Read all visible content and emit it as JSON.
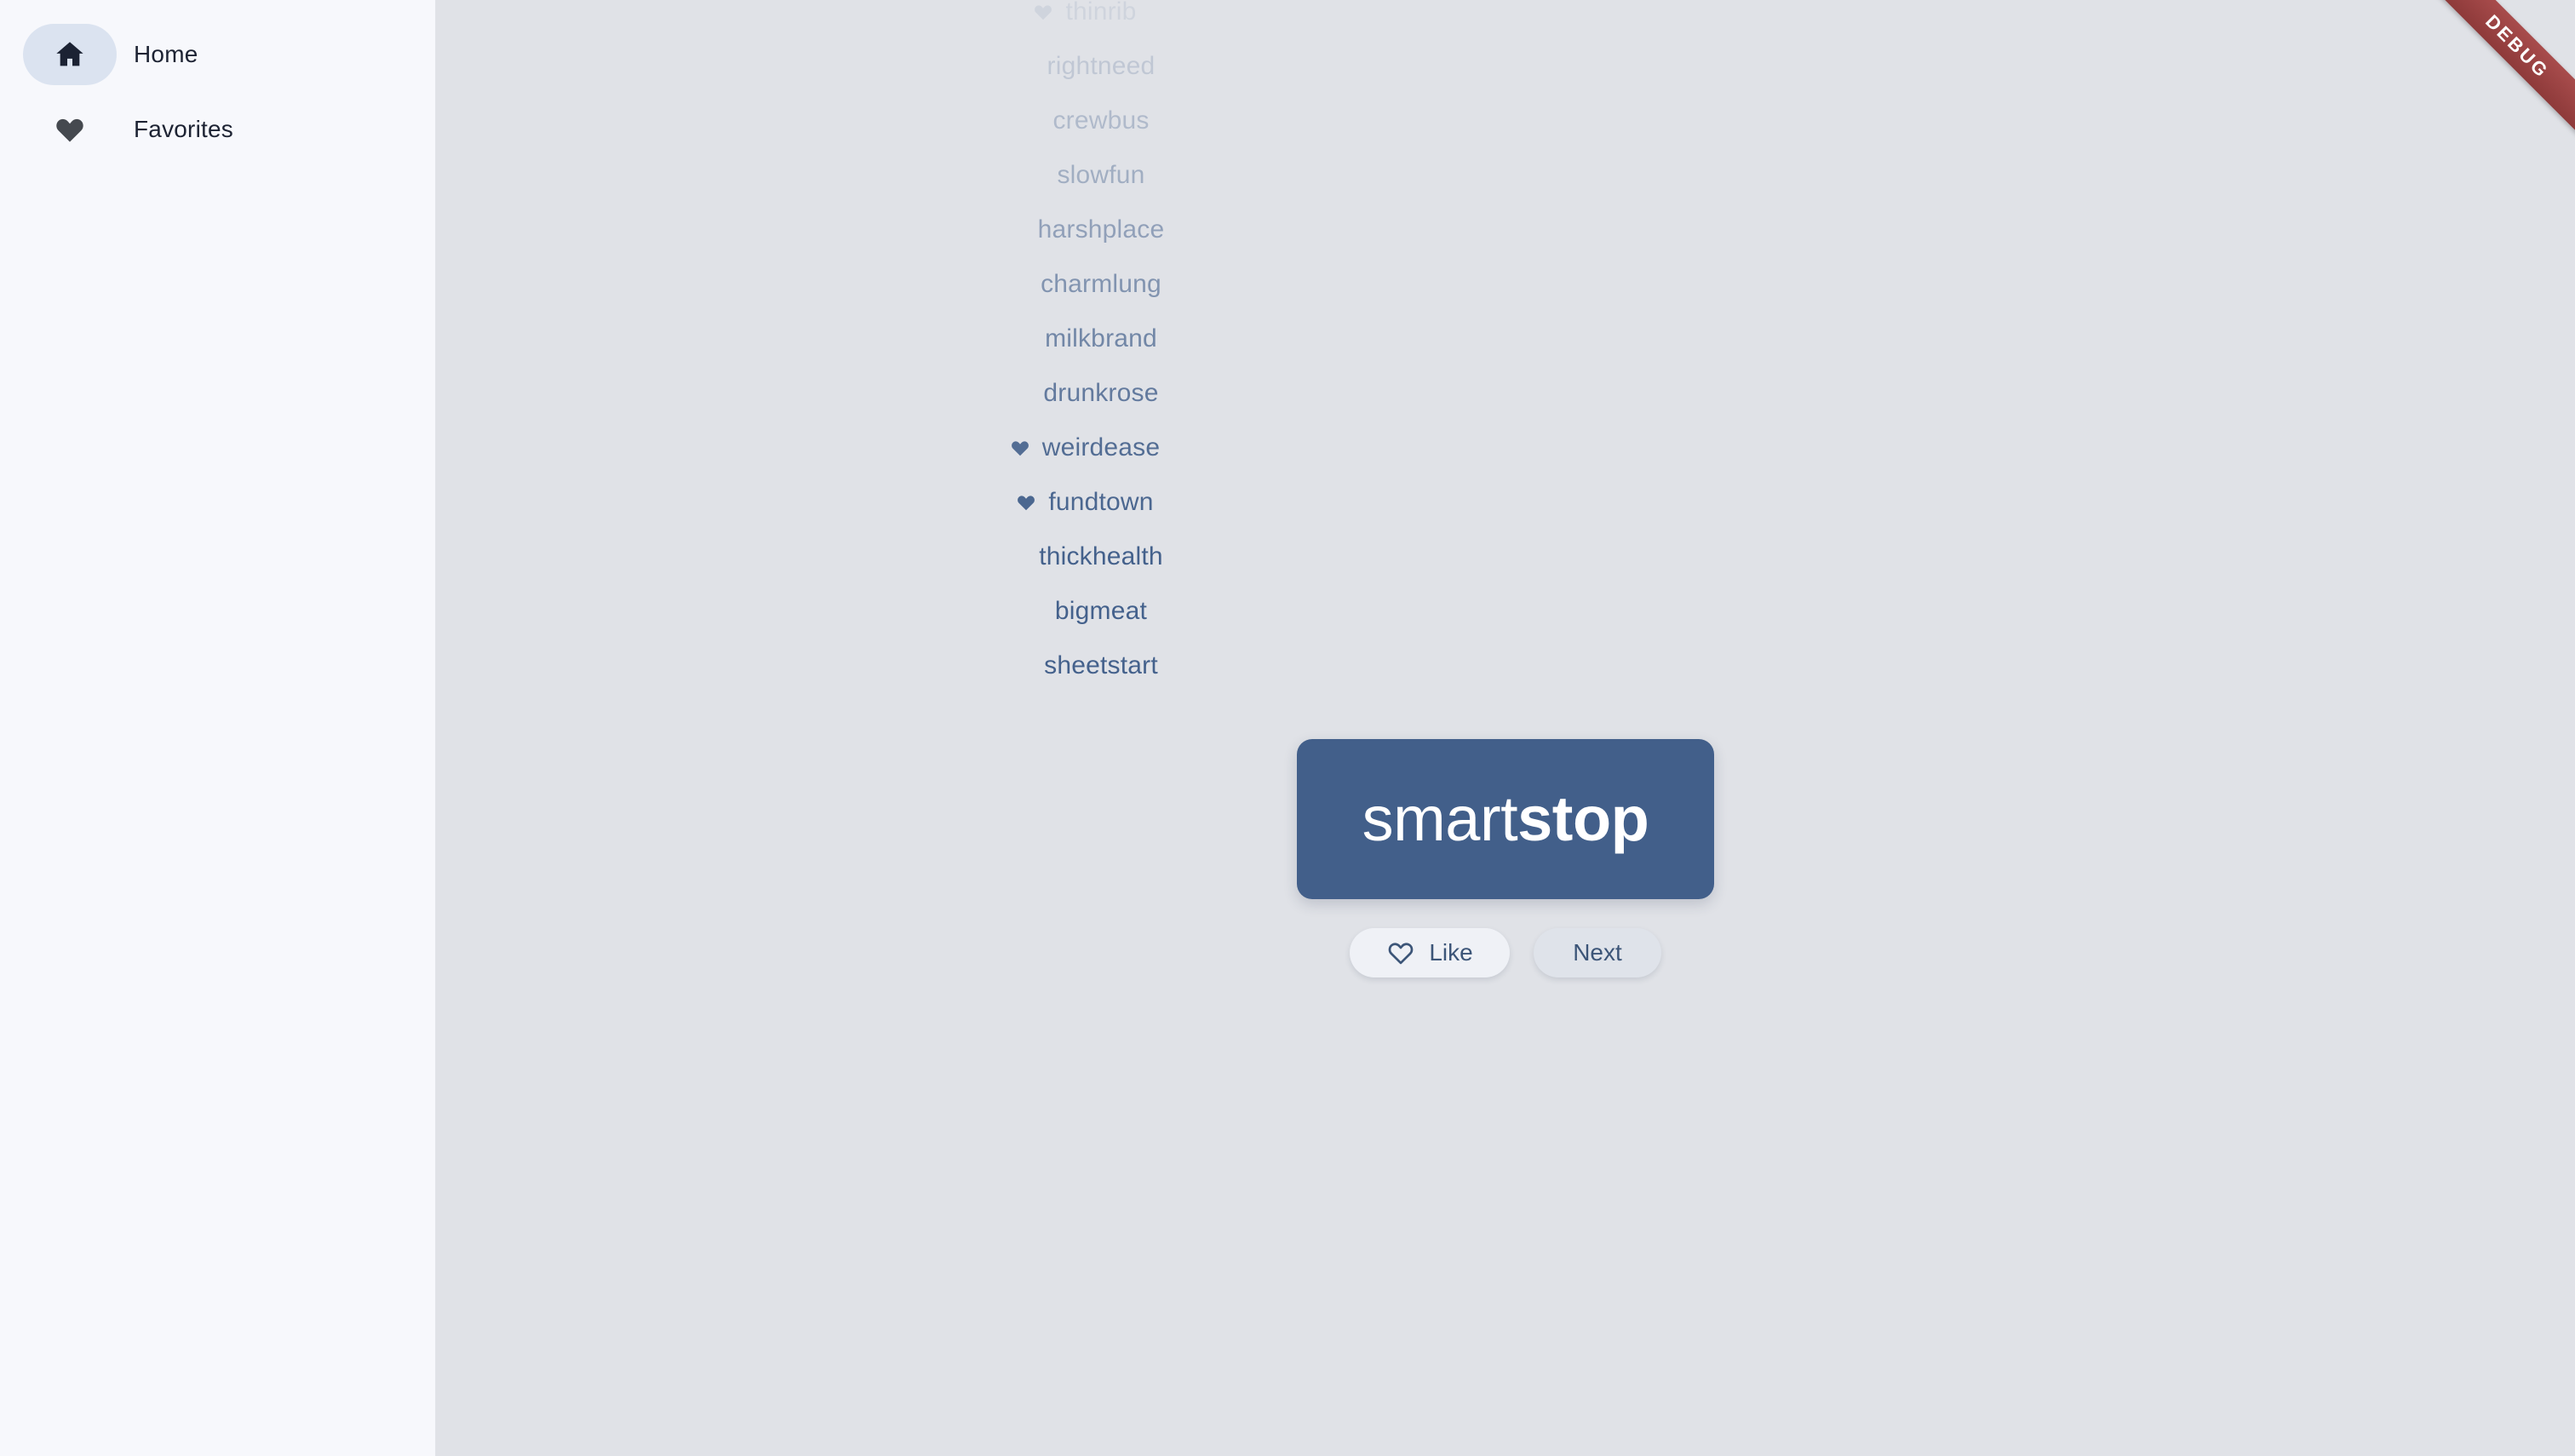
{
  "colors": {
    "sidebar_bg": "#f7f8fc",
    "stage_bg": "#e0e2e7",
    "accent": "#425f8a",
    "word_text": "#44618c",
    "active_pill": "#dbe3f0",
    "like_button_bg": "#eff1f6",
    "next_button_bg": "#dfe3ea",
    "debug_ribbon": "#8e3a3a"
  },
  "sidebar": {
    "items": [
      {
        "label": "Home",
        "icon": "home-icon",
        "active": true
      },
      {
        "label": "Favorites",
        "icon": "heart-filled-icon",
        "active": false
      }
    ]
  },
  "history": {
    "items": [
      {
        "word": "thinrib",
        "liked": true,
        "opacity": 0.1
      },
      {
        "word": "rightneed",
        "liked": false,
        "opacity": 0.2
      },
      {
        "word": "crewbus",
        "liked": false,
        "opacity": 0.3
      },
      {
        "word": "slowfun",
        "liked": false,
        "opacity": 0.4
      },
      {
        "word": "harshplace",
        "liked": false,
        "opacity": 0.5
      },
      {
        "word": "charmlung",
        "liked": false,
        "opacity": 0.6
      },
      {
        "word": "milkbrand",
        "liked": false,
        "opacity": 0.7
      },
      {
        "word": "drunkrose",
        "liked": false,
        "opacity": 0.8
      },
      {
        "word": "weirdease",
        "liked": true,
        "opacity": 0.9
      },
      {
        "word": "fundtown",
        "liked": true,
        "opacity": 0.95
      },
      {
        "word": "thickhealth",
        "liked": false,
        "opacity": 1.0
      },
      {
        "word": "bigmeat",
        "liked": false,
        "opacity": 1.0
      },
      {
        "word": "sheetstart",
        "liked": false,
        "opacity": 1.0
      }
    ]
  },
  "card": {
    "word": "smartstop",
    "word_prefix": "smart",
    "word_suffix": "stop"
  },
  "actions": {
    "like_label": "Like",
    "like_icon": "heart-outline-icon",
    "next_label": "Next"
  },
  "debug": {
    "label": "DEBUG"
  }
}
